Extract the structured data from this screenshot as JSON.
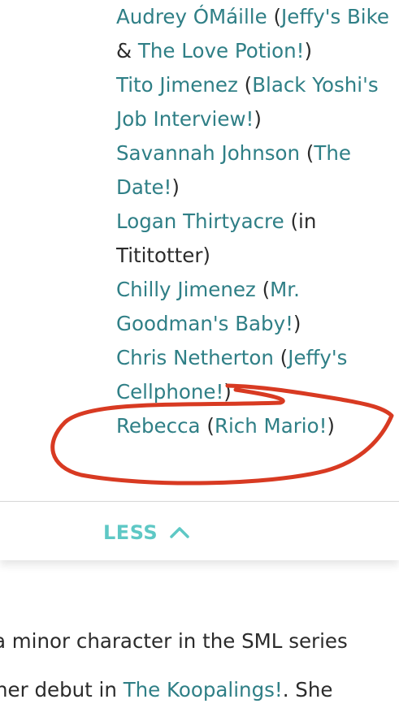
{
  "entries": [
    {
      "lines": [
        [
          {
            "t": "Audrey ÓMáille",
            "link": true
          },
          {
            "t": " (",
            "link": false
          },
          {
            "t": "Jeffy's Bike",
            "link": true
          }
        ],
        [
          {
            "t": "& ",
            "link": false
          },
          {
            "t": "The Love Potion!",
            "link": true
          },
          {
            "t": ")",
            "link": false
          }
        ]
      ]
    },
    {
      "lines": [
        [
          {
            "t": "Tito Jimenez",
            "link": true
          },
          {
            "t": " (",
            "link": false
          },
          {
            "t": "Black Yoshi's",
            "link": true
          }
        ],
        [
          {
            "t": "Job Interview!",
            "link": true
          },
          {
            "t": ")",
            "link": false
          }
        ]
      ]
    },
    {
      "lines": [
        [
          {
            "t": "Savannah Johnson",
            "link": true
          },
          {
            "t": " (",
            "link": false
          },
          {
            "t": "The",
            "link": true
          }
        ],
        [
          {
            "t": "Date!",
            "link": true
          },
          {
            "t": ")",
            "link": false
          }
        ]
      ]
    },
    {
      "lines": [
        [
          {
            "t": "Logan Thirtyacre",
            "link": true
          },
          {
            "t": " (in",
            "link": false
          }
        ],
        [
          {
            "t": "Tititotter)",
            "link": false
          }
        ]
      ]
    },
    {
      "lines": [
        [
          {
            "t": "Chilly Jimenez",
            "link": true
          },
          {
            "t": " (",
            "link": false
          },
          {
            "t": "Mr.",
            "link": true
          }
        ],
        [
          {
            "t": "Goodman's Baby!",
            "link": true
          },
          {
            "t": ")",
            "link": false
          }
        ]
      ]
    },
    {
      "lines": [
        [
          {
            "t": "Chris Netherton",
            "link": true
          },
          {
            "t": " (",
            "link": false
          },
          {
            "t": "Jeffy's",
            "link": true
          }
        ],
        [
          {
            "t": "Cellphone!",
            "link": true
          },
          {
            "t": ")",
            "link": false
          }
        ]
      ]
    },
    {
      "lines": [
        [
          {
            "t": "Rebecca",
            "link": true
          },
          {
            "t": " (",
            "link": false
          },
          {
            "t": "Rich Mario!",
            "link": true
          },
          {
            "t": ")",
            "link": false
          }
        ]
      ]
    }
  ],
  "less_button": {
    "label": "LESS",
    "icon": "chevron-up-icon"
  },
  "bottom_paragraph": [
    [
      {
        "t": "a minor character in the SML series",
        "link": false
      }
    ],
    [
      {
        "t": "her debut in ",
        "link": false
      },
      {
        "t": "The Koopalings!",
        "link": true
      },
      {
        "t": ". She",
        "link": false
      }
    ]
  ],
  "colors": {
    "link": "#2f7f86",
    "less_accent": "#5ec8c5",
    "annotation": "#d83a22"
  }
}
